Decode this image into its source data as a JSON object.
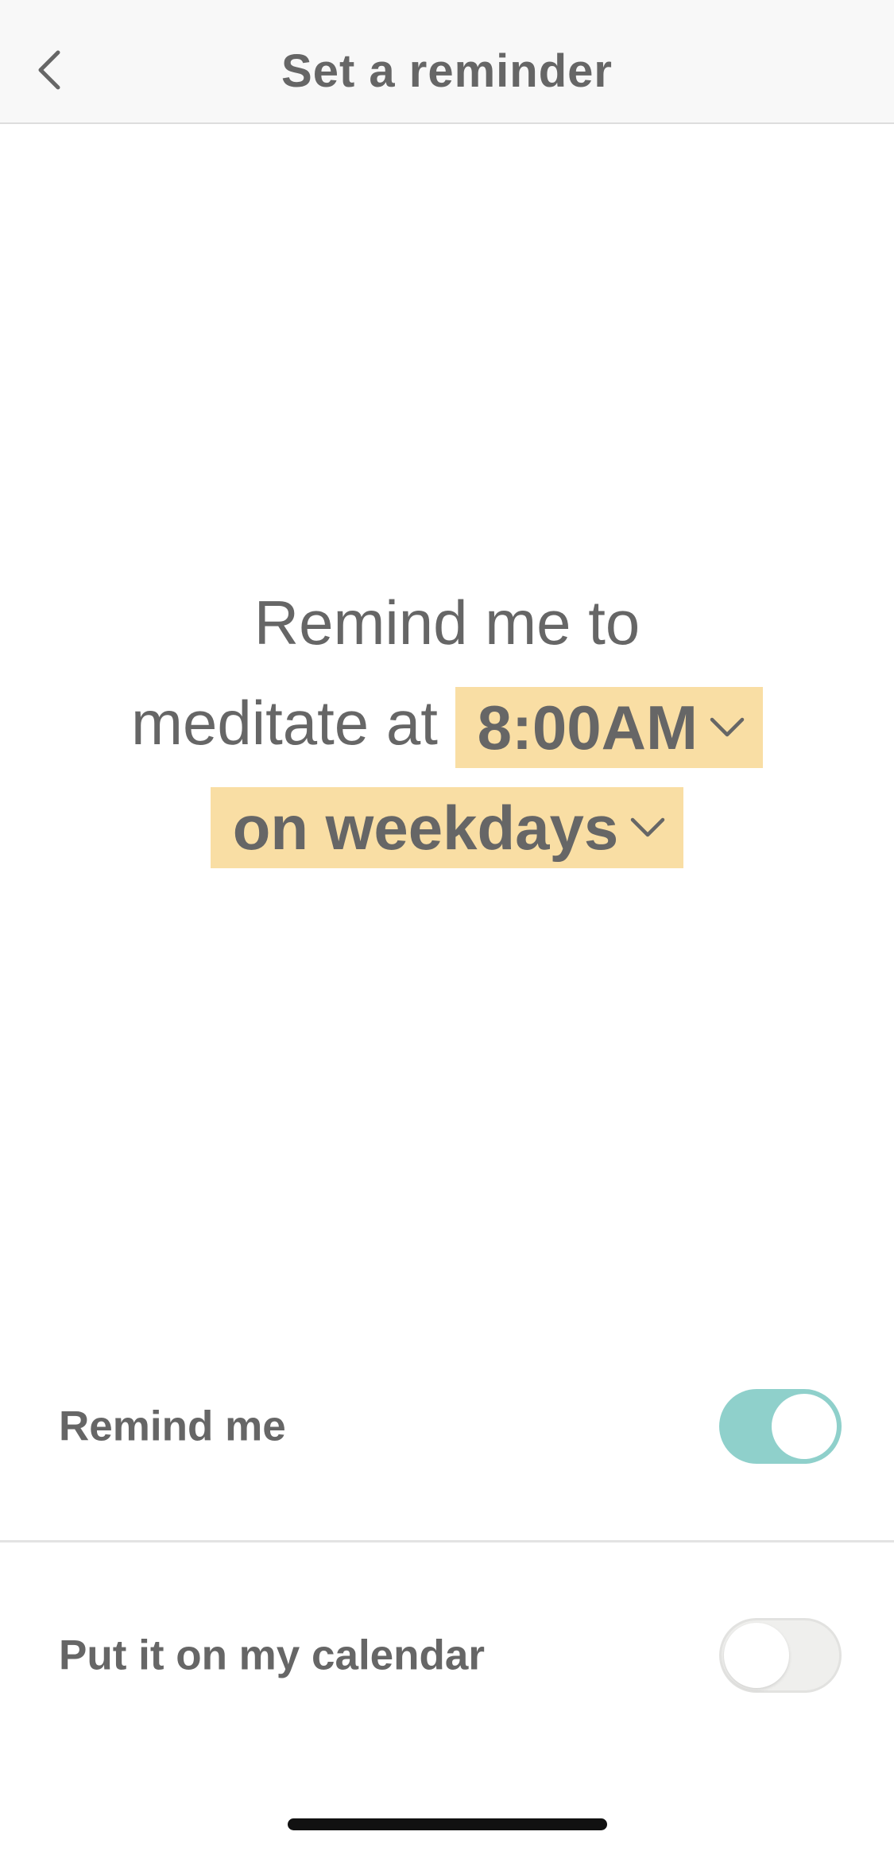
{
  "header": {
    "title": "Set a reminder",
    "back_icon": "chevron-left-icon"
  },
  "sentence": {
    "line1": "Remind me to",
    "line2_prefix": "meditate at",
    "time_value": "8:00AM",
    "frequency_value": "on weekdays",
    "dropdown_icon": "chevron-down-icon",
    "highlight_color": "#f9dea4"
  },
  "settings": {
    "remind_me": {
      "label": "Remind me",
      "enabled": true
    },
    "calendar": {
      "label": "Put it on my calendar",
      "enabled": false
    }
  },
  "colors": {
    "text": "#666666",
    "toggle_on": "#8fd0cb",
    "toggle_off": "#efefed"
  }
}
